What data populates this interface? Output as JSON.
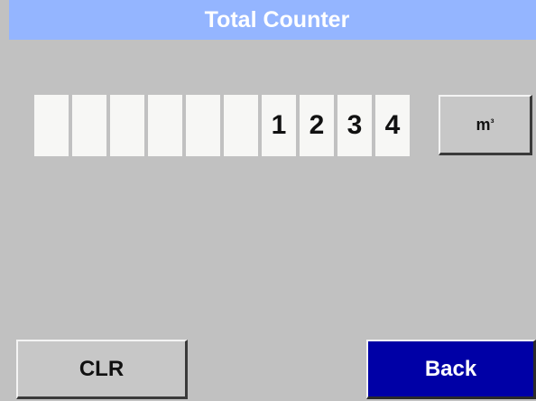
{
  "header": {
    "title": "Total Counter"
  },
  "counter": {
    "digits": [
      "",
      "",
      "",
      "",
      "",
      "",
      "1",
      "2",
      "3",
      "4"
    ]
  },
  "unit_button": {
    "base": "m",
    "exponent": "³"
  },
  "buttons": {
    "clr_label": "CLR",
    "back_label": "Back"
  },
  "colors": {
    "background": "#c1c1c1",
    "title_bar": "#94b5ff",
    "digit_box": "#f7f7f5",
    "back_button": "#0000a6"
  }
}
